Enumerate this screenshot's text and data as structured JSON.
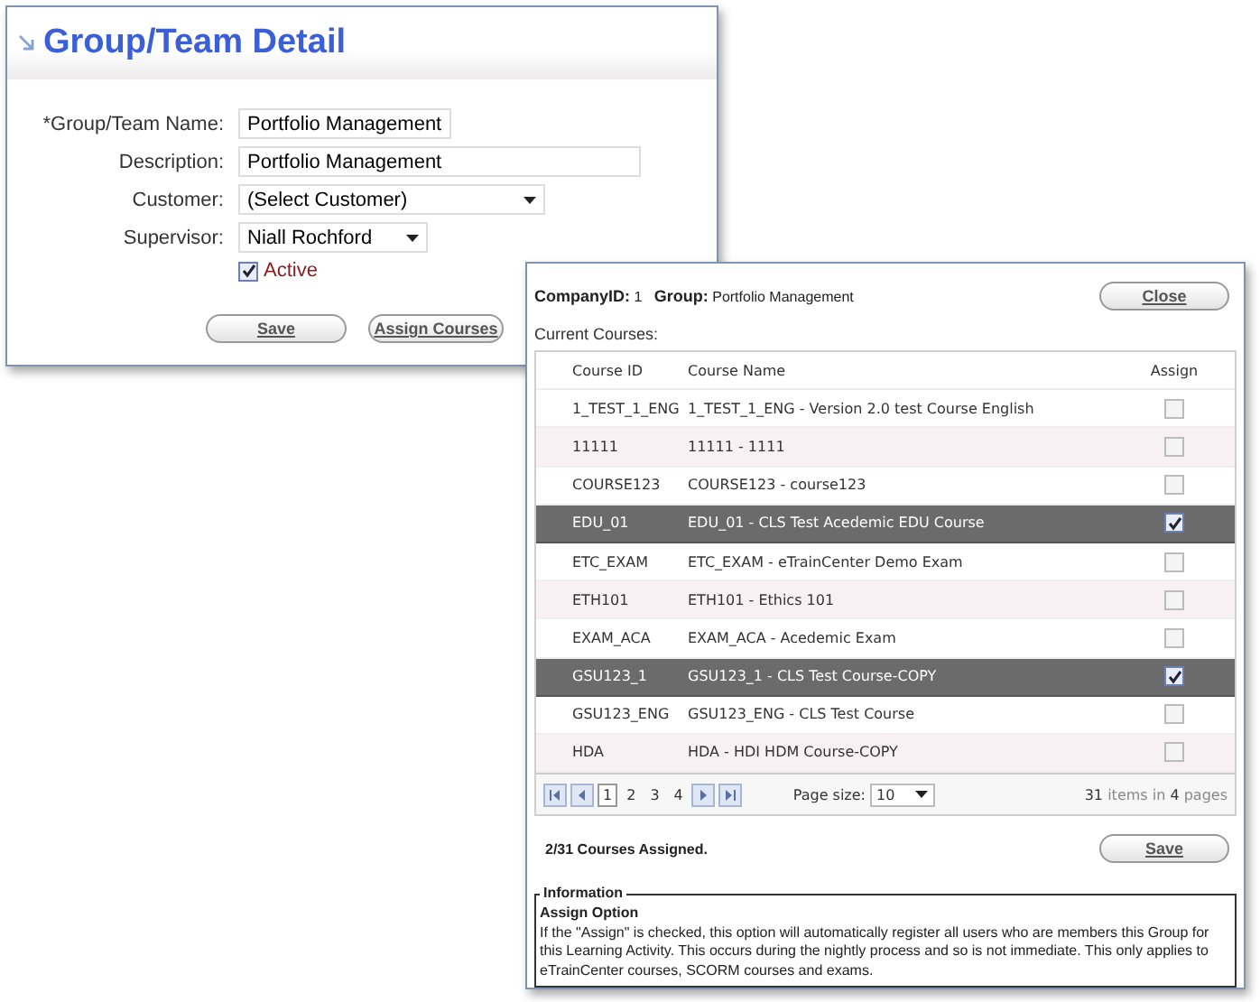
{
  "detail": {
    "title": "Group/Team Detail",
    "fields": [
      {
        "kind": "text",
        "label": "*Group/Team Name:",
        "value": "Portfolio Management",
        "wide": false
      },
      {
        "kind": "text",
        "label": "Description:",
        "value": "Portfolio Management",
        "wide": true
      },
      {
        "kind": "select",
        "label": "Customer:",
        "value": "(Select Customer)",
        "wide": true
      },
      {
        "kind": "select",
        "label": "Supervisor:",
        "value": "Niall Rochford",
        "wide": false
      }
    ],
    "active": {
      "label": "Active",
      "checked": true
    },
    "buttons": [
      "Save",
      "Assign Courses"
    ]
  },
  "courses": {
    "company_label": "CompanyID:",
    "company_id": "1",
    "group_label": "Group:",
    "group": "Portfolio Management",
    "close": "Close",
    "current_label": "Current Courses:",
    "columns": [
      "Course ID",
      "Course Name",
      "Assign"
    ],
    "rows": [
      {
        "id": "1_TEST_1_ENG",
        "name": "1_TEST_1_ENG - Version 2.0 test Course English",
        "checked": false
      },
      {
        "id": "11111",
        "name": "11111 - 1111",
        "checked": false
      },
      {
        "id": "COURSE123",
        "name": "COURSE123 - course123",
        "checked": false
      },
      {
        "id": "EDU_01",
        "name": "EDU_01 - CLS Test Acedemic EDU Course",
        "checked": true
      },
      {
        "id": "ETC_EXAM",
        "name": "ETC_EXAM - eTrainCenter Demo Exam",
        "checked": false
      },
      {
        "id": "ETH101",
        "name": "ETH101 - Ethics 101",
        "checked": false
      },
      {
        "id": "EXAM_ACA",
        "name": "EXAM_ACA - Acedemic Exam",
        "checked": false
      },
      {
        "id": "GSU123_1",
        "name": "GSU123_1 - CLS Test Course-COPY",
        "checked": true
      },
      {
        "id": "GSU123_ENG",
        "name": "GSU123_ENG - CLS Test Course",
        "checked": false
      },
      {
        "id": "HDA",
        "name": "HDA - HDI HDM Course-COPY",
        "checked": false
      }
    ],
    "pages": [
      {
        "label": "1",
        "selected": true
      },
      {
        "label": "2",
        "selected": false
      },
      {
        "label": "3",
        "selected": false
      },
      {
        "label": "4",
        "selected": false
      }
    ],
    "page_size_label": "Page size:",
    "page_size": "10",
    "summary": {
      "count": "31",
      "mid": "items in",
      "pages": "4",
      "end": "pages"
    },
    "assigned": "2/31 Courses Assigned.",
    "save": "Save",
    "info": {
      "legend": "Information",
      "heading": "Assign Option",
      "text": "If the \"Assign\" is checked, this option will automatically register all users who are members this Group for this Learning Activity. This occurs during the nightly process and so is not immediate. This only applies to eTrainCenter courses, SCORM courses and exams."
    }
  }
}
